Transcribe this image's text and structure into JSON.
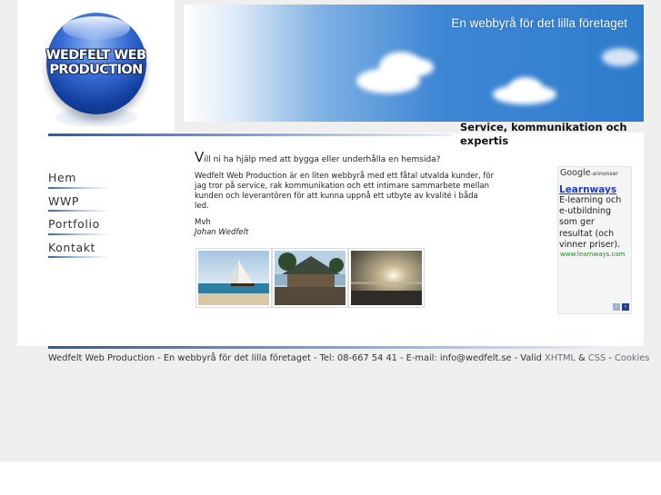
{
  "logo": {
    "text": "WEDFELT WEB PRODUCTION"
  },
  "banner": {
    "tagline": "En webbyrå för det lilla företaget"
  },
  "subtitle": "Service, kommunikation och expertis",
  "nav": {
    "items": [
      {
        "label": "Hem"
      },
      {
        "label": "WWP"
      },
      {
        "label": "Portfolio"
      },
      {
        "label": "Kontakt"
      }
    ]
  },
  "main": {
    "headline_dropcap": "V",
    "headline_rest": "ill ni ha hjälp med att bygga eller underhålla en hemsida?",
    "paragraph": "Wedfelt Web Production är en liten webbyrå med ett fåtal utvalda kunder, för jag tror på service, rak kommunikation och ett intimare sammarbete mellan kunden och leverantören för att kunna uppnå ett utbyte av kvalité i båda led.",
    "greeting": "Mvh",
    "signature": "Johan Wedfelt"
  },
  "thumbnails": [
    {
      "subject": "sailboat-on-sea"
    },
    {
      "subject": "pavilion-by-shore"
    },
    {
      "subject": "sunset-over-water"
    }
  ],
  "ad": {
    "google_label": "Google",
    "google_suffix": "-annonser",
    "title": "Learnways",
    "body": "E-learning och e-utbildning som ger resultat (och vinner priser).",
    "url": "www.learnways.com",
    "prev_icon": "‹",
    "next_icon": "›"
  },
  "footer": {
    "text": "Wedfelt Web Production - En webbyrå för det lilla företaget - Tel: 08-667 54 41 - E-mail: info@wedfelt.se - Valid",
    "xhtml": "XHTML",
    "amp": "&",
    "css": "CSS",
    "sep": "-",
    "cookies": "Cookies"
  },
  "colors": {
    "accent_blue": "#2d5aa0",
    "ad_link": "#1a3bd6",
    "ad_url": "#1c8a1c",
    "page_bg": "#efefef"
  }
}
